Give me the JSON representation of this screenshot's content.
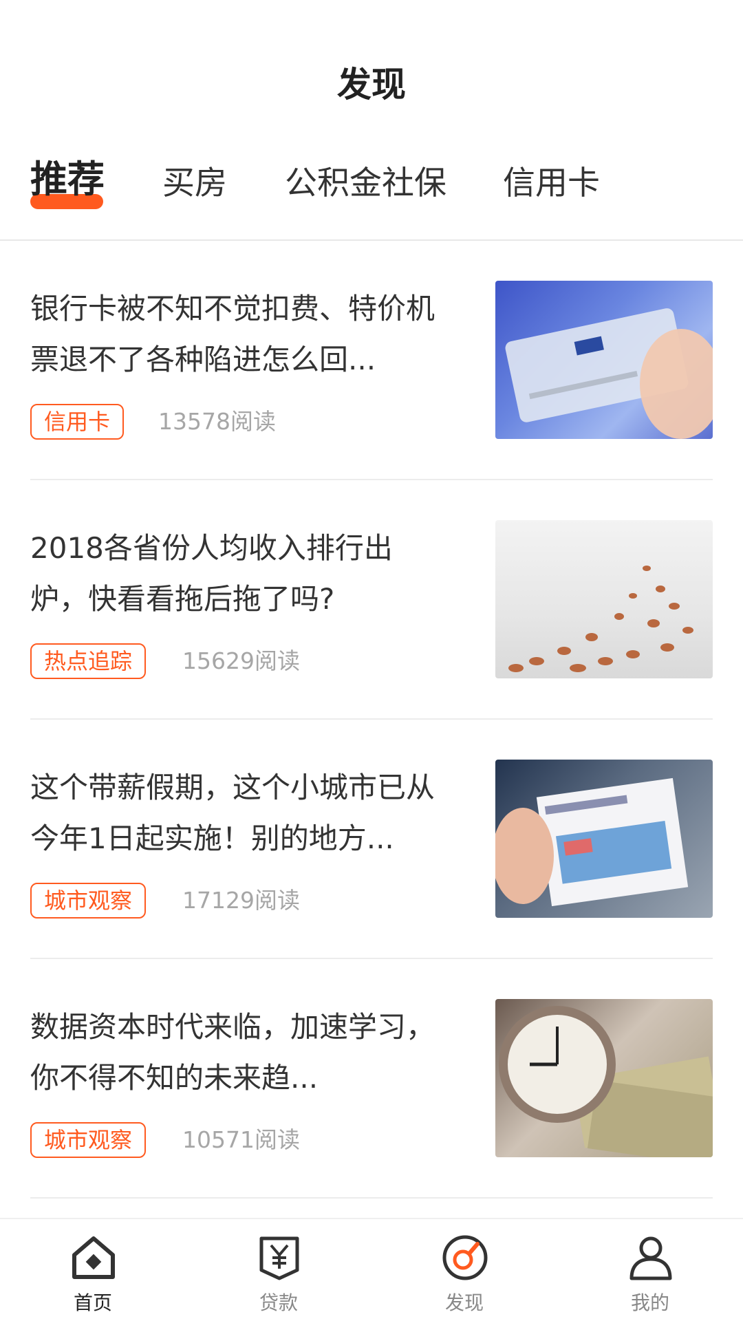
{
  "header": {
    "title": "发现"
  },
  "tabs": [
    {
      "label": "推荐",
      "active": true
    },
    {
      "label": "买房",
      "active": false
    },
    {
      "label": "公积金社保",
      "active": false
    },
    {
      "label": "信用卡",
      "active": false
    }
  ],
  "articles": [
    {
      "title": "银行卡被不知不觉扣费、特价机票退不了各种陷进怎么回...",
      "tag": "信用卡",
      "reads": "13578阅读",
      "thumb": "credit-card-image"
    },
    {
      "title": "2018各省份人均收入排行出炉，快看看拖后拖了吗?",
      "tag": "热点追踪",
      "reads": "15629阅读",
      "thumb": "coins-image"
    },
    {
      "title": "这个带薪假期，这个小城市已从今年1日起实施！别的地方...",
      "tag": "城市观察",
      "reads": "17129阅读",
      "thumb": "boarding-pass-image"
    },
    {
      "title": "数据资本时代来临，加速学习，你不得不知的未来趋...",
      "tag": "城市观察",
      "reads": "10571阅读",
      "thumb": "clock-money-image"
    }
  ],
  "bottom_nav": [
    {
      "label": "首页",
      "icon": "home-icon",
      "active": false
    },
    {
      "label": "贷款",
      "icon": "loan-icon",
      "active": false
    },
    {
      "label": "发现",
      "icon": "discover-icon",
      "active": true
    },
    {
      "label": "我的",
      "icon": "profile-icon",
      "active": false
    }
  ],
  "colors": {
    "accent": "#ff5a1f",
    "text": "#333333",
    "muted": "#a6a6a6"
  }
}
